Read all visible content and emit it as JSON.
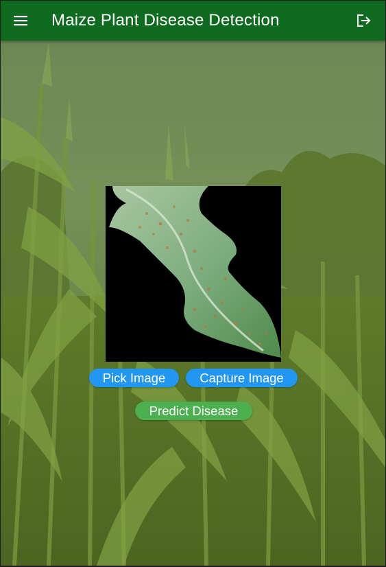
{
  "appbar": {
    "title": "Maize Plant Disease Detection",
    "menu_icon": "menu-icon",
    "logout_icon": "logout-icon",
    "color": "#0f6b1f"
  },
  "preview": {
    "content": "maize leaf with rust spots on black background"
  },
  "actions": {
    "pick_label": "Pick Image",
    "capture_label": "Capture Image",
    "predict_label": "Predict Disease",
    "primary_color": "#2196f3",
    "predict_color": "#4caf50"
  }
}
